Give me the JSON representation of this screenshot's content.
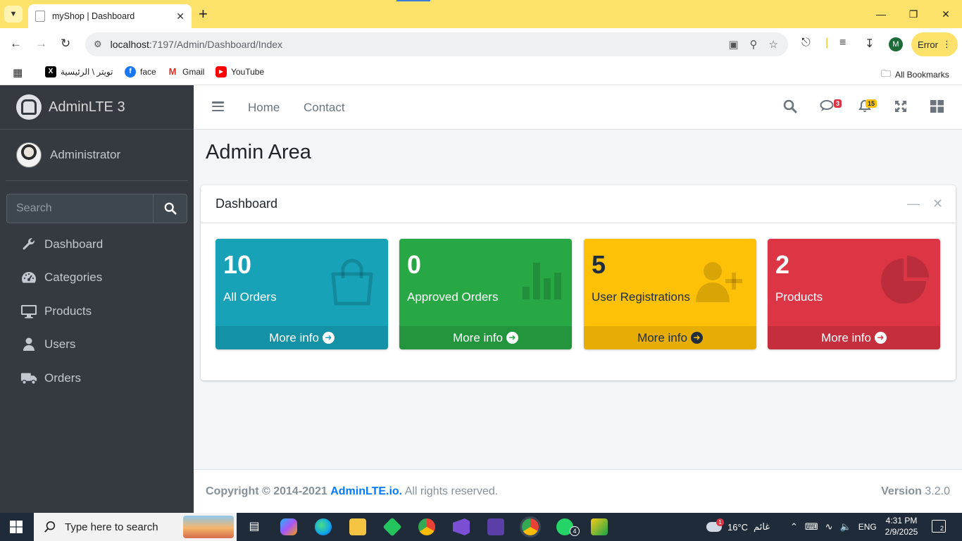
{
  "browser": {
    "tab_title": "myShop | Dashboard",
    "url_host": "localhost",
    "url_path": ":7197/Admin/Dashboard/Index",
    "profile_initial": "M",
    "error_label": "Error",
    "bookmarks": [
      {
        "label": "تويتر \\ الرئيسية",
        "icon": "x-icon"
      },
      {
        "label": "face",
        "icon": "facebook-icon"
      },
      {
        "label": "Gmail",
        "icon": "gmail-icon"
      },
      {
        "label": "YouTube",
        "icon": "youtube-icon"
      }
    ],
    "all_bookmarks": "All Bookmarks"
  },
  "sidebar": {
    "brand": "AdminLTE 3",
    "user": "Administrator",
    "search_placeholder": "Search",
    "items": [
      {
        "label": "Dashboard",
        "icon": "wrench-icon"
      },
      {
        "label": "Categories",
        "icon": "tachometer-icon"
      },
      {
        "label": "Products",
        "icon": "desktop-icon"
      },
      {
        "label": "Users",
        "icon": "user-icon"
      },
      {
        "label": "Orders",
        "icon": "truck-icon"
      }
    ]
  },
  "header": {
    "links": [
      "Home",
      "Contact"
    ],
    "messages_badge": "3",
    "notifications_badge": "15"
  },
  "content": {
    "page_title": "Admin Area",
    "card_title": "Dashboard",
    "boxes": [
      {
        "number": "10",
        "label": "All Orders",
        "footer": "More info",
        "icon": "shopping-bag-icon",
        "color": "#17a2b8"
      },
      {
        "number": "0",
        "label": "Approved Orders",
        "footer": "More info",
        "icon": "bar-chart-icon",
        "color": "#28a745"
      },
      {
        "number": "5",
        "label": "User Registrations",
        "footer": "More info",
        "icon": "user-plus-icon",
        "color": "#ffc107"
      },
      {
        "number": "2",
        "label": "Products",
        "footer": "More info",
        "icon": "pie-chart-icon",
        "color": "#dc3545"
      }
    ]
  },
  "footer": {
    "copyright": "Copyright © 2014-2021",
    "brand_link": "AdminLTE.io.",
    "rights": "All rights reserved.",
    "version_label": "Version",
    "version": "3.2.0"
  },
  "taskbar": {
    "search_placeholder": "Type here to search",
    "weather_temp": "16°C",
    "weather_text": "غائم",
    "weather_badge": "1",
    "language": "ENG",
    "time": "4:31 PM",
    "date": "2/9/2025",
    "notification_count": "2",
    "whatsapp_badge": "4"
  }
}
